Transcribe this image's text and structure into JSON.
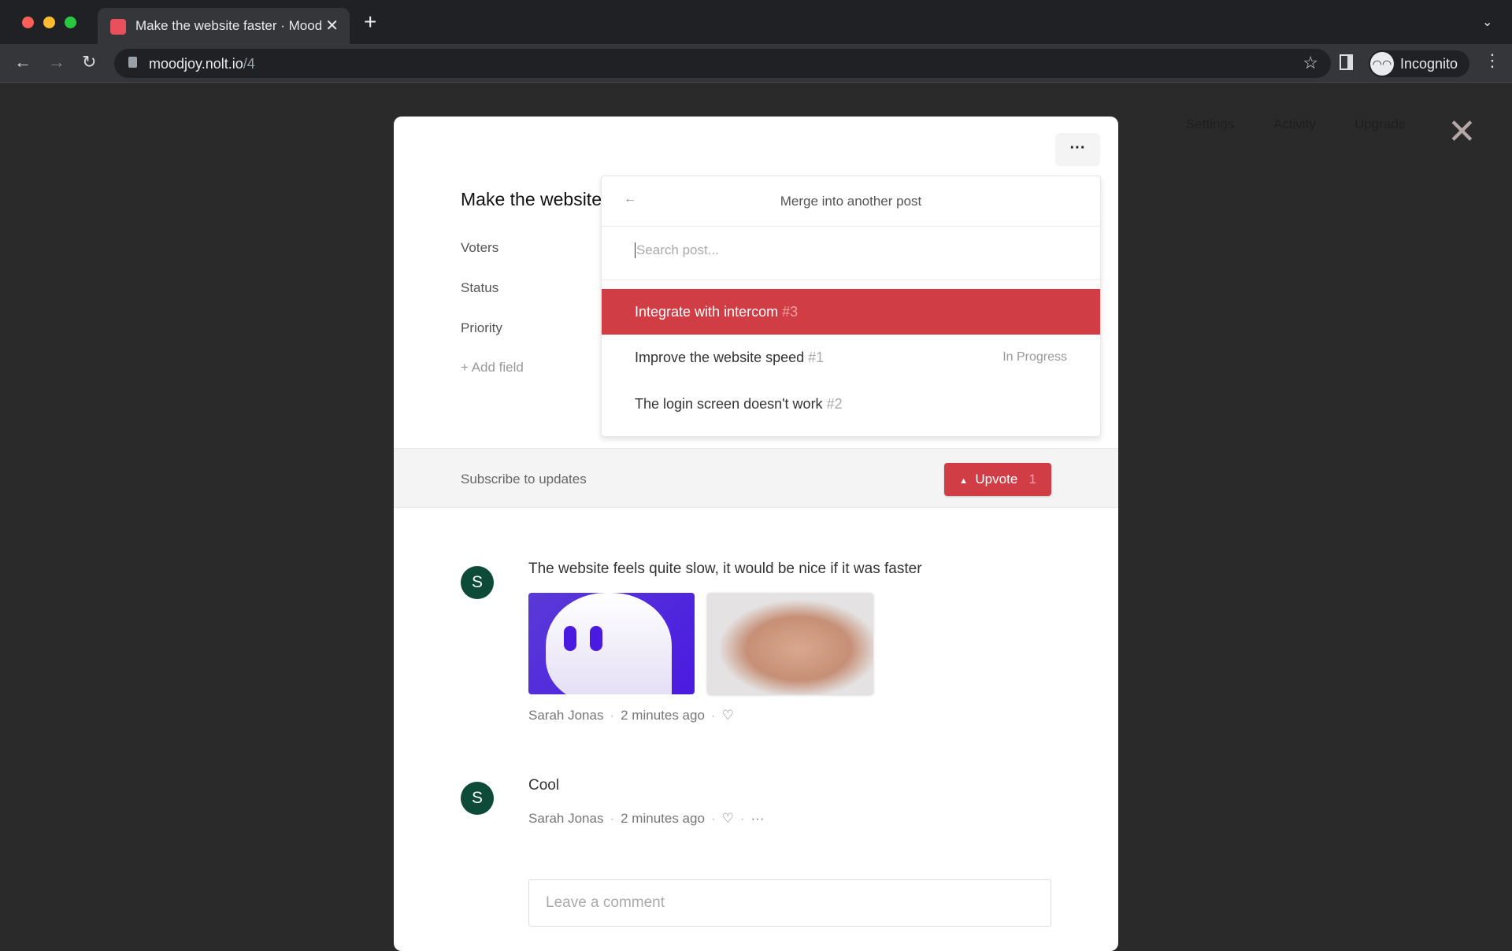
{
  "browser": {
    "tab_title": "Make the website faster · Moodjoy",
    "url_host": "moodjoy.nolt.io",
    "url_path": "/4",
    "profile": "Incognito",
    "icons": [
      "back-icon",
      "forward-icon",
      "reload-icon",
      "lock-icon",
      "star-icon",
      "sidepanel-icon",
      "incognito-icon",
      "menu-icon"
    ]
  },
  "background_nav": {
    "items": [
      "Settings",
      "Activity",
      "Upgrade"
    ]
  },
  "post": {
    "title": "Make the website faster",
    "fields": [
      "Voters",
      "Status",
      "Priority"
    ],
    "add_field": "+ Add field"
  },
  "merge": {
    "title": "Merge into another post",
    "search_placeholder": "Search post...",
    "results": [
      {
        "name": "Integrate with intercom",
        "num": "#3",
        "status": "",
        "selected": true
      },
      {
        "name": "Improve the website speed",
        "num": "#1",
        "status": "In Progress"
      },
      {
        "name": "The login screen doesn't work",
        "num": "#2",
        "status": ""
      }
    ]
  },
  "actions": {
    "subscribe": "Subscribe to updates",
    "upvote_label": "Upvote",
    "upvote_count": "1"
  },
  "comments": [
    {
      "avatar": "S",
      "text": "The website feels quite slow, it would be nice if it was faster",
      "author": "Sarah Jonas",
      "time": "2 minutes ago"
    },
    {
      "avatar": "S",
      "text": "Cool",
      "author": "Sarah Jonas",
      "time": "2 minutes ago"
    }
  ],
  "comment_input": {
    "placeholder": "Leave a comment"
  },
  "colors": {
    "accent": "#d13d45",
    "avatar": "#0d4a38"
  }
}
